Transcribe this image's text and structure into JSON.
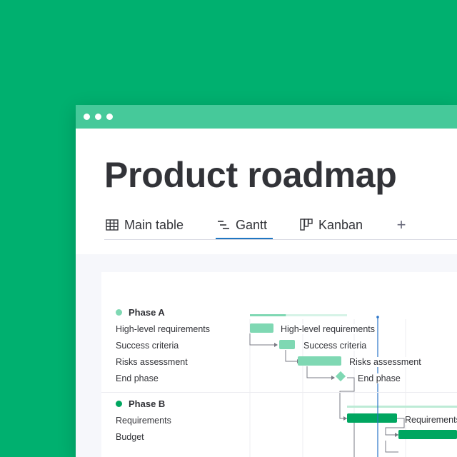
{
  "page": {
    "title": "Product roadmap"
  },
  "colors": {
    "background": "#00b06f",
    "titlebar": "#46c99a",
    "accent": "#1f76c2",
    "phase_a": "#7fd8b3",
    "phase_b": "#00a660",
    "today_line": "#2b74c8"
  },
  "tabs": [
    {
      "label": "Main table",
      "icon": "table-icon",
      "active": false
    },
    {
      "label": "Gantt",
      "icon": "gantt-icon",
      "active": true
    },
    {
      "label": "Kanban",
      "icon": "kanban-icon",
      "active": false
    }
  ],
  "add_tab": {
    "label": "+"
  },
  "groups": [
    {
      "name": "Phase A",
      "progress": 0.37,
      "items": [
        {
          "label": "High-level requirements",
          "bar_label": "High-level requirements"
        },
        {
          "label": "Success criteria",
          "bar_label": "Success criteria"
        },
        {
          "label": "Risks assessment",
          "bar_label": "Risks assessment"
        },
        {
          "label": "End phase",
          "bar_label": "End phase",
          "milestone": true
        }
      ]
    },
    {
      "name": "Phase B",
      "items": [
        {
          "label": "Requirements",
          "bar_label": "Requirements"
        },
        {
          "label": "Budget",
          "bar_label": ""
        }
      ]
    }
  ]
}
